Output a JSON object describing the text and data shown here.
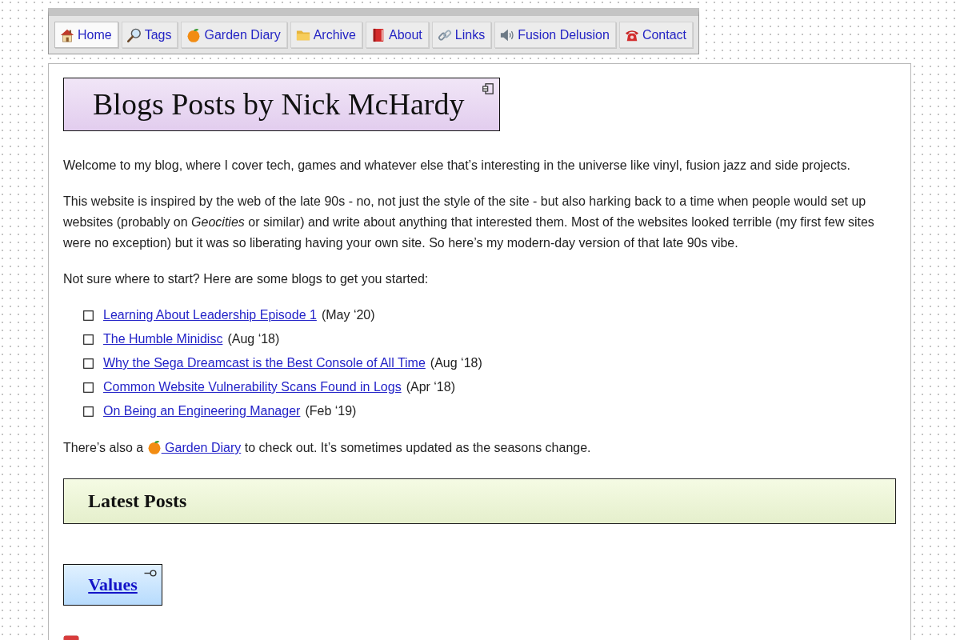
{
  "nav": [
    {
      "label": "Home",
      "selected": true
    },
    {
      "label": "Tags",
      "selected": false
    },
    {
      "label": "Garden Diary",
      "selected": false
    },
    {
      "label": "Archive",
      "selected": false
    },
    {
      "label": "About",
      "selected": false
    },
    {
      "label": "Links",
      "selected": false
    },
    {
      "label": "Fusion Delusion",
      "selected": false
    },
    {
      "label": "Contact",
      "selected": false
    }
  ],
  "title": "Blogs Posts by Nick McHardy",
  "intro": [
    "Welcome to my blog, where I cover tech, games and whatever else that’s interesting in the universe like vinyl, fusion jazz and side projects.",
    "This website is inspired by the web of the late 90s - no, not just the style of the site - but also harking back to a time when people would set up websites (probably on *Geocities* or similar) and write about anything that interested them. Most of the websites looked terrible (my first few sites were no exception) but it was so liberating having your own site. So here’s my modern-day version of that late 90s vibe.",
    "Not sure where to start? Here are some blogs to get you started:"
  ],
  "featured_posts": [
    {
      "title": "Learning About Leadership Episode 1",
      "date": "(May ‘20)"
    },
    {
      "title": "The Humble Minidisc",
      "date": "(Aug ‘18)"
    },
    {
      "title": "Why the Sega Dreamcast is the Best Console of All Time",
      "date": "(Aug ‘18)"
    },
    {
      "title": "Common Website Vulnerability Scans Found in Logs",
      "date": "(Apr ‘18)"
    },
    {
      "title": "On Being an Engineering Manager",
      "date": "(Feb ‘19)"
    }
  ],
  "garden_note": {
    "before": "There’s also a",
    "link": "Garden Diary",
    "after": "to check out. It’s sometimes updated as the seasons change."
  },
  "latest_posts": {
    "heading": "Latest Posts",
    "categories": [
      {
        "label": "Values"
      }
    ]
  }
}
